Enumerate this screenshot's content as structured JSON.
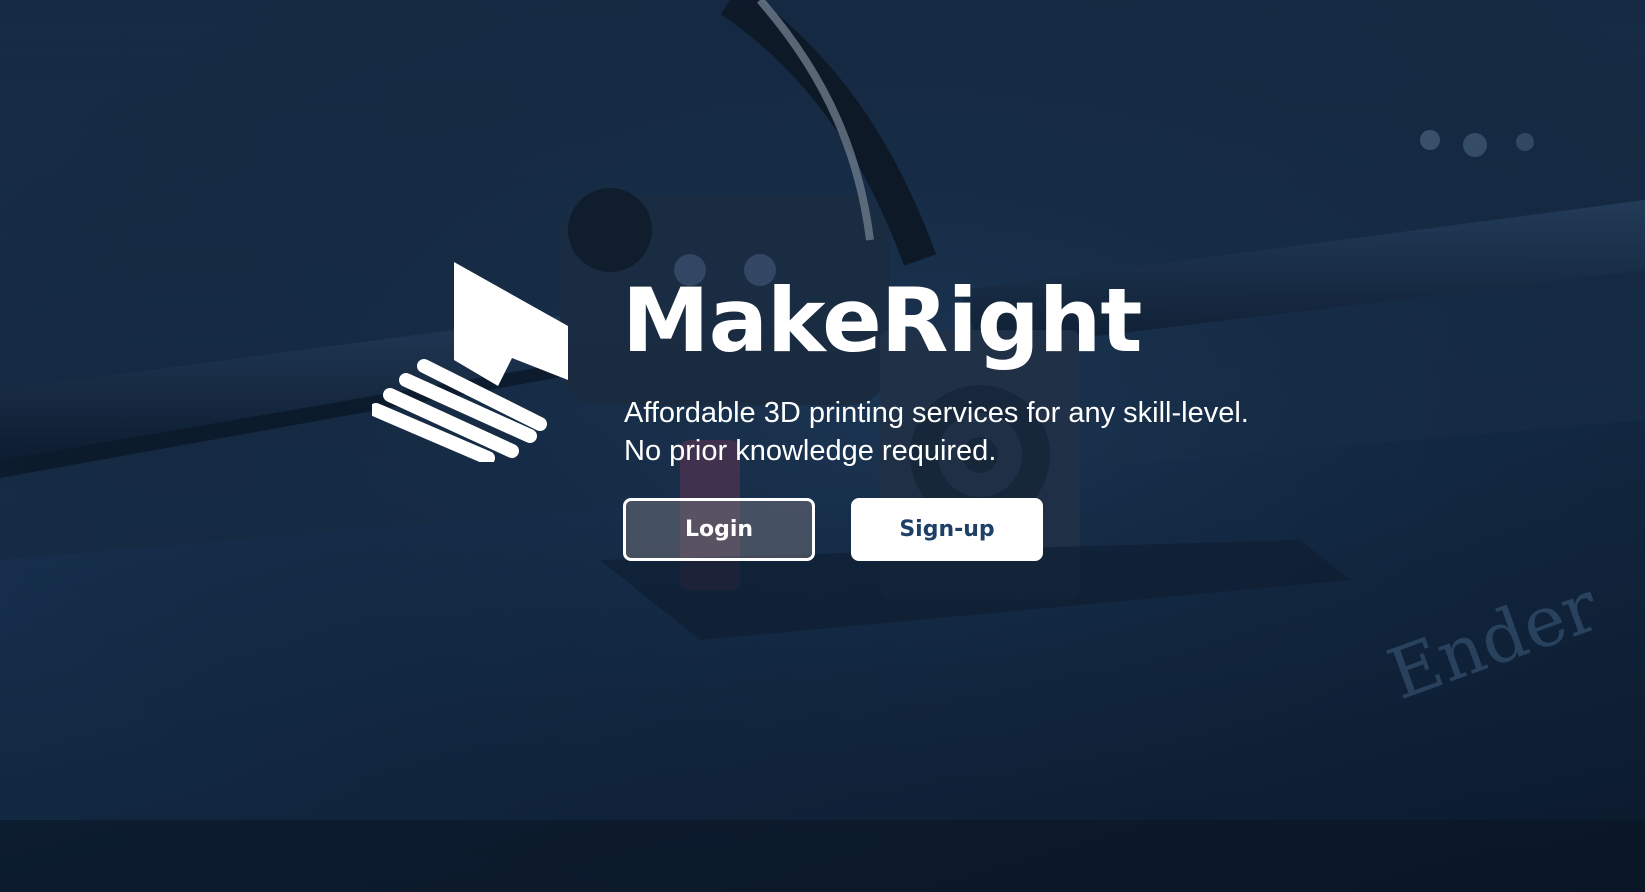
{
  "brand": {
    "name": "MakeRight",
    "logo": "makeright-logo-icon"
  },
  "tagline": {
    "line1": "Affordable 3D printing services for any skill-level.",
    "line2": "No prior knowledge required."
  },
  "actions": {
    "login_label": "Login",
    "signup_label": "Sign-up"
  },
  "background": {
    "description": "3d-printer-photo",
    "tint": "#15304f"
  },
  "colors": {
    "primary_text": "#ffffff",
    "signup_text": "#1e3f66"
  }
}
